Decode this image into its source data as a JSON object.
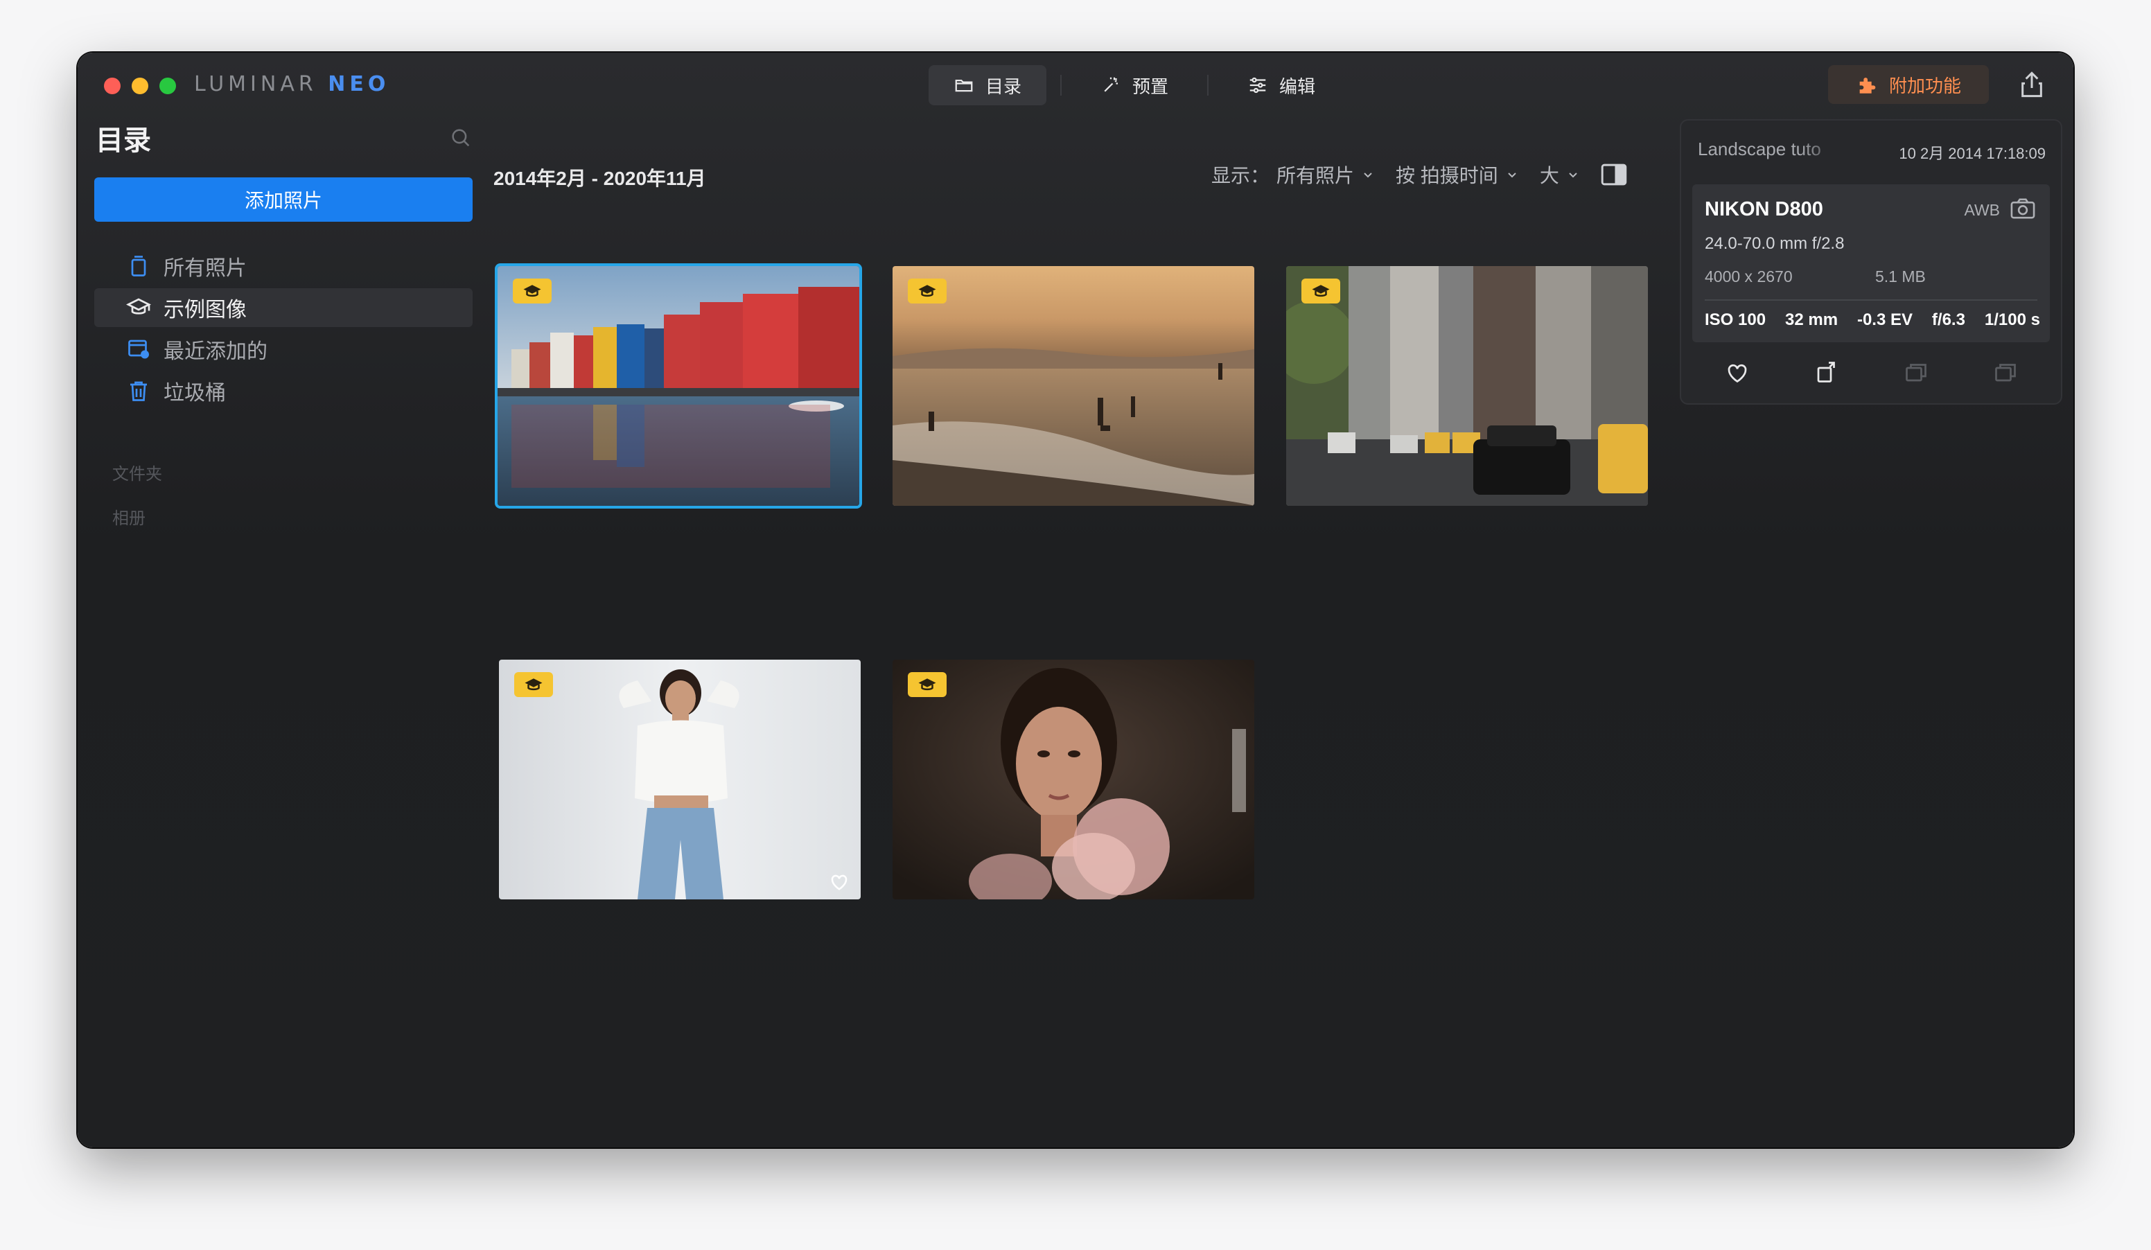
{
  "app": {
    "brand_main": "LUMINAR",
    "brand_accent": "NEO"
  },
  "topnav": {
    "tabs": [
      {
        "label": "目录",
        "icon": "folder-icon",
        "active": true
      },
      {
        "label": "预置",
        "icon": "magic-wand-icon",
        "active": false
      },
      {
        "label": "编辑",
        "icon": "sliders-icon",
        "active": false
      }
    ],
    "extras_label": "附加功能"
  },
  "sidebar": {
    "title": "目录",
    "add_button": "添加照片",
    "items": [
      {
        "label": "所有照片",
        "icon": "photos-stack-icon",
        "active": false
      },
      {
        "label": "示例图像",
        "icon": "graduation-cap-icon",
        "active": true
      },
      {
        "label": "最近添加的",
        "icon": "recent-added-icon",
        "active": false
      },
      {
        "label": "垃圾桶",
        "icon": "trash-icon",
        "active": false
      }
    ],
    "sections": [
      "文件夹",
      "相册"
    ]
  },
  "main": {
    "date_range": "2014年2月 - 2020年11月",
    "show_label": "显示：",
    "filter_value": "所有照片",
    "sort_value": "按 拍摄时间",
    "size_value": "大"
  },
  "thumbnails": [
    {
      "name": "harbor-houses",
      "selected": true,
      "badge": true,
      "favorite": false
    },
    {
      "name": "beach-sunset",
      "selected": false,
      "badge": true,
      "favorite": false
    },
    {
      "name": "city-street",
      "selected": false,
      "badge": true,
      "favorite": false
    },
    {
      "name": "woman-white-top",
      "selected": false,
      "badge": true,
      "favorite": true
    },
    {
      "name": "portrait-woman",
      "selected": false,
      "badge": true,
      "favorite": false
    }
  ],
  "info": {
    "file_name": "Landscape tuto",
    "date": "10 2月 2014 17:18:09",
    "camera": "NIKON D800",
    "wb": "AWB",
    "lens": "24.0-70.0 mm f/2.8",
    "dimensions": "4000 x 2670",
    "file_size": "5.1 MB",
    "iso": "ISO 100",
    "focal": "32 mm",
    "ev": "-0.3 EV",
    "aperture": "f/6.3",
    "shutter": "1/100 s"
  },
  "colors": {
    "accent_blue": "#1a7ff0",
    "selection": "#26a6e8",
    "extras_orange": "#ff8f50",
    "badge_yellow": "#f5c431"
  }
}
